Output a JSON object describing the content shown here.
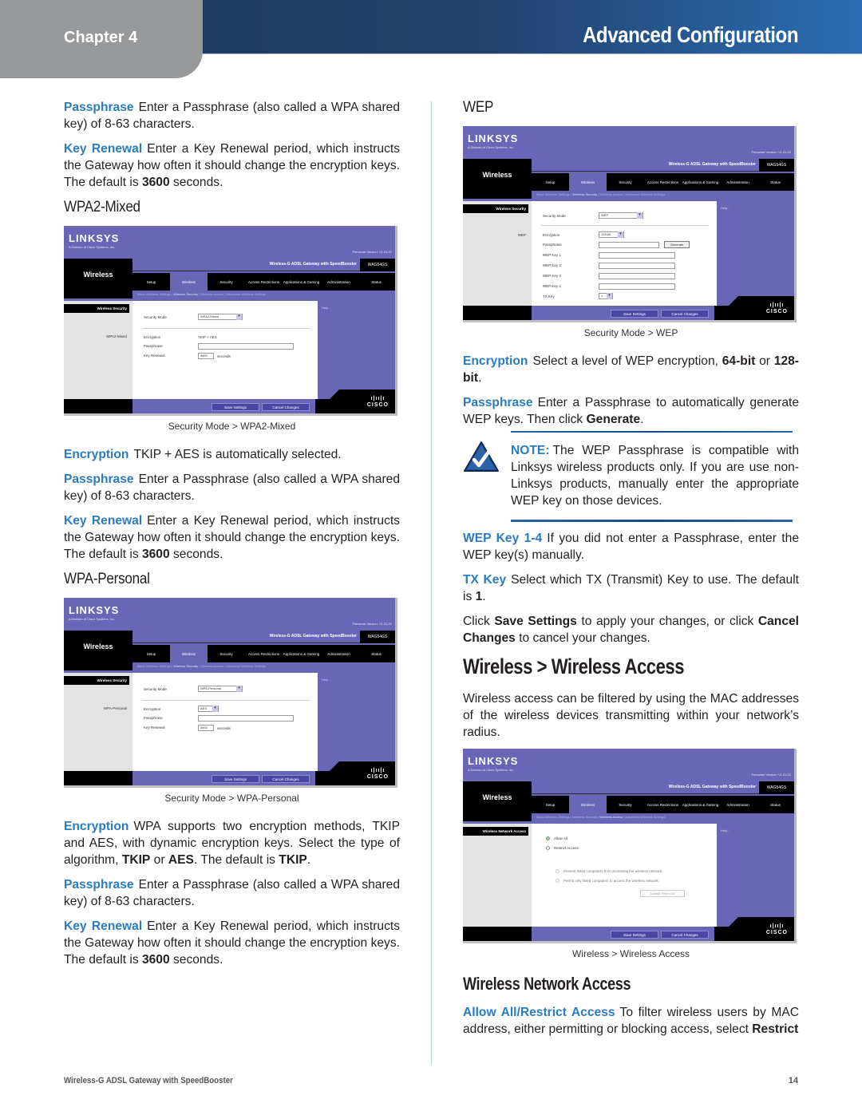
{
  "header": {
    "chapter": "Chapter 4",
    "section_title": "Advanced Configuration"
  },
  "left_column": {
    "top_paragraphs": [
      {
        "term": "Passphrase",
        "text": "Enter a Passphrase (also called a WPA shared key) of 8-63 characters."
      },
      {
        "term": "Key Renewal",
        "text_before": "Enter a Key Renewal period, which instructs the Gateway how often it should change the encryption keys. The default is ",
        "bold": "3600",
        "text_after": " seconds."
      }
    ],
    "wpa2_mixed": {
      "heading": "WPA2-Mixed",
      "caption": "Security Mode > WPA2-Mixed",
      "paragraphs": [
        {
          "term": "Encryption",
          "text": "TKIP + AES is automatically selected."
        },
        {
          "term": "Passphrase",
          "text": "Enter a Passphrase (also called a WPA shared key) of 8-63 characters."
        },
        {
          "term": "Key Renewal",
          "text_before": "Enter a Key Renewal period, which instructs the Gateway how often it should change the encryption keys. The default is ",
          "bold": "3600",
          "text_after": " seconds."
        }
      ]
    },
    "wpa_personal": {
      "heading": "WPA-Personal",
      "caption": "Security Mode > WPA-Personal",
      "paragraphs": [
        {
          "term": "Encryption",
          "text_before": "WPA supports two encryption methods, TKIP and AES, with dynamic encryption keys. Select the type of algorithm, ",
          "bold1": "TKIP",
          "mid1": " or ",
          "bold2": "AES",
          "mid2": ". The default is ",
          "bold3": "TKIP",
          "text_after": "."
        },
        {
          "term": "Passphrase",
          "text": "Enter a Passphrase (also called a WPA shared key) of 8-63 characters."
        },
        {
          "term": "Key Renewal",
          "text_before": "Enter a Key Renewal period, which instructs the Gateway how often it should change the encryption keys. The default is ",
          "bold": "3600",
          "text_after": " seconds."
        }
      ]
    }
  },
  "right_column": {
    "wep": {
      "heading": "WEP",
      "caption": "Security Mode > WEP",
      "encryption": {
        "term": "Encryption",
        "text_before": "Select a level of WEP encryption, ",
        "bold1": "64-bit",
        "mid": " or ",
        "bold2": "128-bit",
        "text_after": "."
      },
      "passphrase": {
        "term": "Passphrase",
        "text_before": "Enter a Passphrase to automatically generate WEP keys. Then click ",
        "bold": "Generate",
        "text_after": "."
      },
      "note": {
        "label": "NOTE:",
        "text": "The WEP Passphrase is compatible with Linksys wireless products only. If you are use non-Linksys products, manually enter the appropriate WEP key on those devices."
      },
      "wep_key": {
        "term": "WEP Key 1-4",
        "text": "If you did not enter a Passphrase, enter the WEP key(s) manually."
      },
      "tx_key": {
        "term": "TX Key",
        "text_before": "Select which TX (Transmit) Key to use. The default is ",
        "bold": "1",
        "text_after": "."
      },
      "save_note": {
        "t1": "Click ",
        "b1": "Save Settings",
        "t2": " to apply your changes, or click ",
        "b2": "Cancel Changes",
        "t3": " to cancel your changes."
      }
    },
    "wireless_access": {
      "heading": "Wireless > Wireless Access",
      "intro": "Wireless access can be filtered by using the MAC addresses of the wireless devices transmitting within your network’s radius.",
      "caption": "Wireless > Wireless Access",
      "subheading": "Wireless Network Access",
      "allow": {
        "term": "Allow All/Restrict Access",
        "text_before": "To filter wireless users by MAC address, either permitting or blocking access, select ",
        "bold": "Restrict"
      }
    }
  },
  "router_ui": {
    "logo": "LINKSYS",
    "logo_sub": "A Division of Cisco Systems, Inc.",
    "firmware": "Firmware Version: V1.01.02",
    "section": "Wireless",
    "product": "Wireless-G ADSL Gateway with SpeedBooster",
    "model": "WAG54GS",
    "tabs": [
      "Setup",
      "Wireless",
      "Security",
      "Access Restrictions",
      "Applications & Gaming",
      "Administration",
      "Status"
    ],
    "subtabs": [
      "Basic Wireless Settings",
      "Wireless Security",
      "Wireless Access",
      "Advanced Wireless Settings"
    ],
    "help": "Help...",
    "save_button": "Save Settings",
    "cancel_button": "Cancel Changes",
    "cisco": "CISCO",
    "security_header": "Wireless Security",
    "security_mode_label": "Security Mode",
    "encryption_label": "Encryption",
    "passphrase_label": "Passphrase",
    "key_renewal_label": "Key Renewal",
    "seconds": "seconds",
    "key_renewal_value": "3600",
    "wpa2_mixed": {
      "mode": "WPA2-Mixed",
      "encryption": "TKIP + AES"
    },
    "wpa_personal": {
      "mode": "WPA-Personal",
      "encryption": "AES"
    },
    "wep": {
      "mode": "WEP",
      "encryption": "128-bit",
      "generate": "Generate",
      "key_labels": [
        "WEP Key 1",
        "WEP Key 2",
        "WEP Key 3",
        "WEP Key 4"
      ],
      "tx_key_label": "TX Key",
      "tx_key_value": "1"
    },
    "access": {
      "header": "Wireless Network Access",
      "allow_all": "Allow All",
      "restrict": "Restrict Access",
      "prevent": "Prevent listed computers from accessing the wireless network",
      "permit": "Permit only listed computers to access the wireless network",
      "edit_list": "Update Filter List"
    }
  },
  "footer": {
    "product": "Wireless-G ADSL Gateway with SpeedBooster",
    "page": "14"
  }
}
